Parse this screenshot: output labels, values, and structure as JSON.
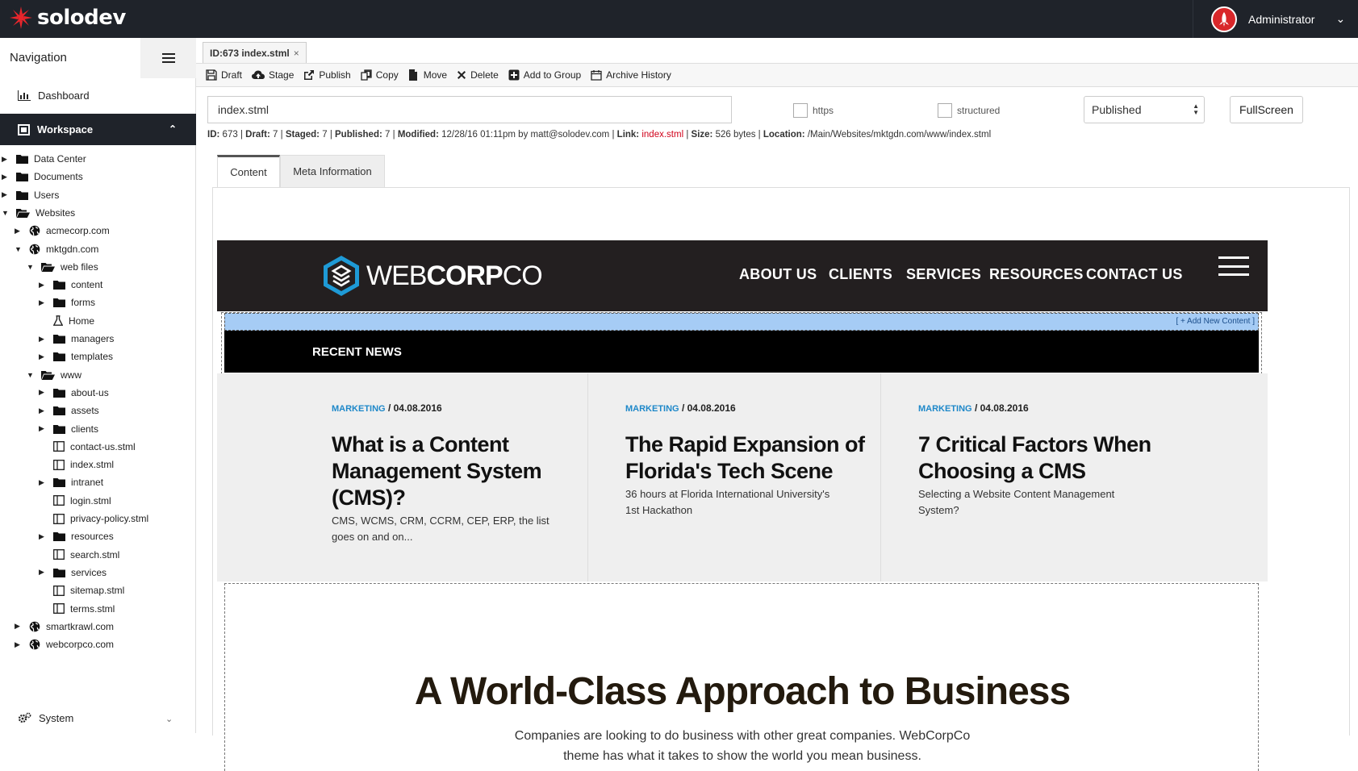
{
  "app": {
    "brand": "solodev",
    "user": "Administrator"
  },
  "sidebar": {
    "nav_label": "Navigation",
    "dashboard": "Dashboard",
    "workspace": "Workspace",
    "system": "System",
    "tree": [
      {
        "label": "Data Center",
        "type": "folder",
        "level": 0,
        "toggle": "closed"
      },
      {
        "label": "Documents",
        "type": "folder",
        "level": 0,
        "toggle": "closed"
      },
      {
        "label": "Users",
        "type": "folder",
        "level": 0,
        "toggle": "closed"
      },
      {
        "label": "Websites",
        "type": "folder-open",
        "level": 0,
        "toggle": "open"
      },
      {
        "label": "acmecorp.com",
        "type": "globe",
        "level": 1,
        "toggle": "closed"
      },
      {
        "label": "mktgdn.com",
        "type": "globe",
        "level": 1,
        "toggle": "open"
      },
      {
        "label": "web files",
        "type": "folder-open",
        "level": 2,
        "toggle": "open"
      },
      {
        "label": "content",
        "type": "folder",
        "level": 3,
        "toggle": "closed"
      },
      {
        "label": "forms",
        "type": "folder",
        "level": 3,
        "toggle": "closed"
      },
      {
        "label": "Home",
        "type": "flask",
        "level": 3,
        "toggle": ""
      },
      {
        "label": "managers",
        "type": "folder",
        "level": 3,
        "toggle": "closed"
      },
      {
        "label": "templates",
        "type": "folder",
        "level": 3,
        "toggle": "closed"
      },
      {
        "label": "www",
        "type": "folder-open",
        "level": 2,
        "toggle": "open"
      },
      {
        "label": "about-us",
        "type": "folder",
        "level": 3,
        "toggle": "closed"
      },
      {
        "label": "assets",
        "type": "folder",
        "level": 3,
        "toggle": "closed"
      },
      {
        "label": "clients",
        "type": "folder",
        "level": 3,
        "toggle": "closed"
      },
      {
        "label": "contact-us.stml",
        "type": "file",
        "level": 3,
        "toggle": ""
      },
      {
        "label": "index.stml",
        "type": "file",
        "level": 3,
        "toggle": ""
      },
      {
        "label": "intranet",
        "type": "folder",
        "level": 3,
        "toggle": "closed"
      },
      {
        "label": "login.stml",
        "type": "file",
        "level": 3,
        "toggle": ""
      },
      {
        "label": "privacy-policy.stml",
        "type": "file",
        "level": 3,
        "toggle": ""
      },
      {
        "label": "resources",
        "type": "folder",
        "level": 3,
        "toggle": "closed"
      },
      {
        "label": "search.stml",
        "type": "file",
        "level": 3,
        "toggle": ""
      },
      {
        "label": "services",
        "type": "folder",
        "level": 3,
        "toggle": "closed"
      },
      {
        "label": "sitemap.stml",
        "type": "file",
        "level": 3,
        "toggle": ""
      },
      {
        "label": "terms.stml",
        "type": "file",
        "level": 3,
        "toggle": ""
      },
      {
        "label": "smartkrawl.com",
        "type": "globe",
        "level": 1,
        "toggle": "closed"
      },
      {
        "label": "webcorpco.com",
        "type": "globe",
        "level": 1,
        "toggle": "closed"
      }
    ]
  },
  "editor": {
    "file_tab": "ID:673 index.stml",
    "file_tab_close": "×",
    "toolbar": {
      "draft": "Draft",
      "stage": "Stage",
      "publish": "Publish",
      "copy": "Copy",
      "move": "Move",
      "delete": "Delete",
      "add_group": "Add to Group",
      "archive": "Archive History"
    },
    "filename": "index.stml",
    "https_label": "https",
    "structured_label": "structured",
    "status": "Published",
    "fullscreen": "FullScreen",
    "info": {
      "id_label": "ID:",
      "id": "673",
      "draft_label": "Draft:",
      "draft": "7",
      "staged_label": "Staged:",
      "staged": "7",
      "published_label": "Published:",
      "published": "7",
      "modified_label": "Modified:",
      "modified": "12/28/16 01:11pm by matt@solodev.com",
      "link_label": "Link:",
      "link": "index.stml",
      "size_label": "Size:",
      "size": "526 bytes",
      "location_label": "Location:",
      "location": "/Main/Websites/mktgdn.com/www/index.stml",
      "sep": "|"
    },
    "tabs": {
      "content": "Content",
      "meta": "Meta Information"
    }
  },
  "preview": {
    "logo_light": "WEB",
    "logo_bold": "CORP",
    "logo_light2": "CO",
    "menu": [
      "ABOUT US",
      "CLIENTS",
      "SERVICES",
      "RESOURCES",
      "CONTACT US"
    ],
    "add_content": "[ + Add New Content ]",
    "recent_news": "RECENT NEWS",
    "cards": [
      {
        "category": "MARKETING",
        "date": "/ 04.08.2016",
        "title_lines": [
          "What is a Content",
          "Management System",
          "(CMS)?"
        ],
        "desc_lines": [
          "CMS, WCMS, CRM, CCRM, CEP, ERP, the list",
          "goes on and on..."
        ]
      },
      {
        "category": "MARKETING",
        "date": "/ 04.08.2016",
        "title_lines": [
          "The Rapid Expansion of",
          "Florida's Tech Scene"
        ],
        "desc_lines": [
          "36 hours at Florida International University's",
          "1st Hackathon"
        ]
      },
      {
        "category": "MARKETING",
        "date": "/ 04.08.2016",
        "title_lines": [
          "7 Critical Factors When",
          "Choosing a CMS"
        ],
        "desc_lines": [
          "Selecting a Website Content Management",
          "System?"
        ]
      }
    ],
    "headline": "A World-Class Approach to Business",
    "tagline_lines": [
      "Companies are looking to do business with other great companies. WebCorpCo",
      "theme has what it takes to show the world you mean business."
    ]
  },
  "colors": {
    "topbar": "#1f232a",
    "accent_red": "#d9272a",
    "link_red": "#d0021b",
    "category_blue": "#1e88c9",
    "site_nav": "#231f20",
    "addbar": "#a6ccf5"
  }
}
